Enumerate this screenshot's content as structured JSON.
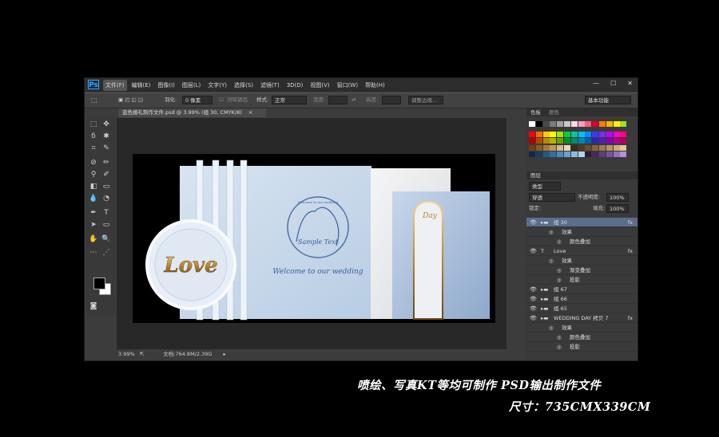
{
  "app": {
    "logo": "Ps",
    "window_controls": [
      "—",
      "☐",
      "✕"
    ]
  },
  "menu": [
    "文件(F)",
    "编辑(E)",
    "图像(I)",
    "图层(L)",
    "文字(Y)",
    "选择(S)",
    "滤镜(T)",
    "3D(D)",
    "视图(V)",
    "窗口(W)",
    "帮助(H)"
  ],
  "options": {
    "feather_label": "羽化:",
    "feather_value": "0 像素",
    "antialias_label": "消除锯齿",
    "style_label": "样式:",
    "style_value": "正常",
    "width_label": "宽度:",
    "height_label": "高度:",
    "refine_edge": "调整边缘...",
    "workspace": "基本功能"
  },
  "document": {
    "tab_title": "蓝色婚礼制作文件.psd @ 3.99% (组 30, CMYK/8)",
    "zoom": "3.99%",
    "doc_size": "文档:764.8M/2.39G"
  },
  "artwork": {
    "love_text": "Love",
    "sample_text": "Sample Text",
    "circle_text": "Welcome to our wedding",
    "welcome_text": "Welcome to our wedding",
    "wedding_day": "Day"
  },
  "panels": {
    "tab_swatches": "色板",
    "tab_color": "颜色",
    "layers_title": "图层",
    "kind": "类型",
    "blend_mode": "穿透",
    "opacity_label": "不透明度:",
    "opacity_value": "100%",
    "lock_label": "锁定:",
    "fill_label": "填充:",
    "fill_value": "100%"
  },
  "layers": [
    {
      "name": "组 30",
      "indent": 0,
      "selected": true,
      "fx": true,
      "kind": "folder"
    },
    {
      "name": "效果",
      "indent": 1,
      "selected": false,
      "fx": false,
      "kind": "effect"
    },
    {
      "name": "颜色叠加",
      "indent": 2,
      "selected": false,
      "fx": false,
      "kind": "effect"
    },
    {
      "name": "Love",
      "indent": 0,
      "selected": false,
      "fx": true,
      "kind": "text"
    },
    {
      "name": "效果",
      "indent": 1,
      "selected": false,
      "fx": false,
      "kind": "effect"
    },
    {
      "name": "渐变叠加",
      "indent": 2,
      "selected": false,
      "fx": false,
      "kind": "effect"
    },
    {
      "name": "投影",
      "indent": 2,
      "selected": false,
      "fx": false,
      "kind": "effect"
    },
    {
      "name": "组 67",
      "indent": 0,
      "selected": false,
      "fx": false,
      "kind": "folder"
    },
    {
      "name": "组 66",
      "indent": 0,
      "selected": false,
      "fx": false,
      "kind": "folder"
    },
    {
      "name": "组 65",
      "indent": 0,
      "selected": false,
      "fx": false,
      "kind": "folder"
    },
    {
      "name": "WEDDING DAY 拷贝 7",
      "indent": 0,
      "selected": false,
      "fx": true,
      "kind": "folder"
    },
    {
      "name": "效果",
      "indent": 1,
      "selected": false,
      "fx": false,
      "kind": "effect"
    },
    {
      "name": "颜色叠加",
      "indent": 2,
      "selected": false,
      "fx": false,
      "kind": "effect"
    },
    {
      "name": "投影",
      "indent": 2,
      "selected": false,
      "fx": false,
      "kind": "effect"
    }
  ],
  "caption": {
    "line1": "喷绘、写真KT等均可制作  PSD输出制作文件",
    "line2": "尺寸：735CMX339CM"
  }
}
